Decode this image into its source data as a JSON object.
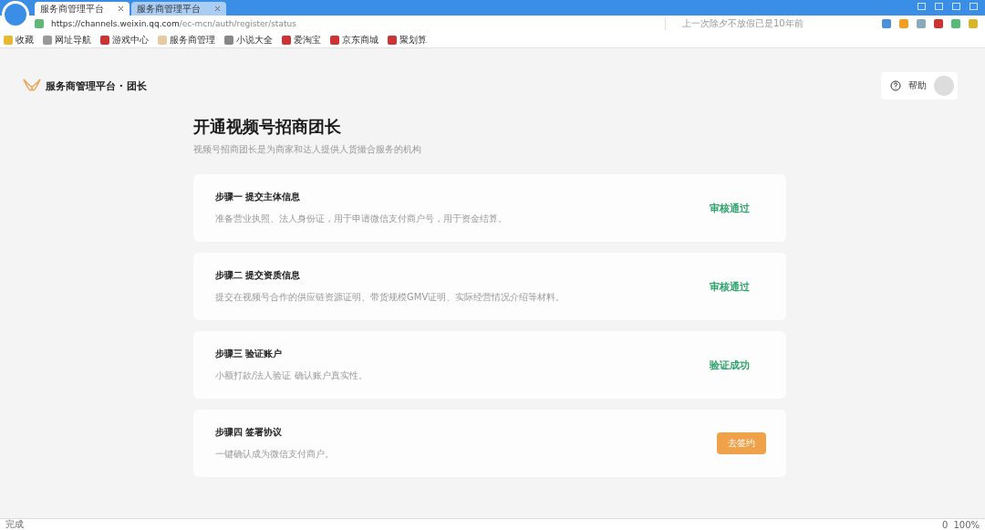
{
  "browser": {
    "tabs": [
      {
        "title": "服务商管理平台",
        "selected": true
      },
      {
        "title": "服务商管理平台",
        "selected": false
      }
    ],
    "url_host": "https://channels.weixin.qq.com",
    "url_path": "/ec-mcn/auth/register/status",
    "search_placeholder": "上一次除夕不放假已是10年前",
    "bookmarks": [
      {
        "label": "收藏"
      },
      {
        "label": "网址导航"
      },
      {
        "label": "游戏中心"
      },
      {
        "label": "服务商管理"
      },
      {
        "label": "小说大全"
      },
      {
        "label": "爱淘宝"
      },
      {
        "label": "京东商城"
      },
      {
        "label": "聚划算"
      }
    ]
  },
  "header": {
    "brand": "服务商管理平台 · 团长",
    "help": "帮助"
  },
  "title": "开通视频号招商团长",
  "subtitle": "视频号招商团长是为商家和达人提供人货撮合服务的机构",
  "steps": [
    {
      "title": "步骤一 提交主体信息",
      "desc": "准备营业执照、法人身份证，用于申请微信支付商户号，用于资金结算。",
      "kind": "status",
      "status": "审核通过"
    },
    {
      "title": "步骤二 提交资质信息",
      "desc": "提交在视频号合作的供应链资源证明、带货规模GMV证明、实际经营情况介绍等材料。",
      "kind": "status",
      "status": "审核通过"
    },
    {
      "title": "步骤三 验证账户",
      "desc": "小额打款/法人验证 确认账户真实性。",
      "kind": "status",
      "status": "验证成功"
    },
    {
      "title": "步骤四 签署协议",
      "desc": "一键确认成为微信支付商户。",
      "kind": "action",
      "status": "去签约"
    }
  ],
  "status_bar": {
    "left": "完成",
    "count": "0",
    "zoom": "100%"
  }
}
